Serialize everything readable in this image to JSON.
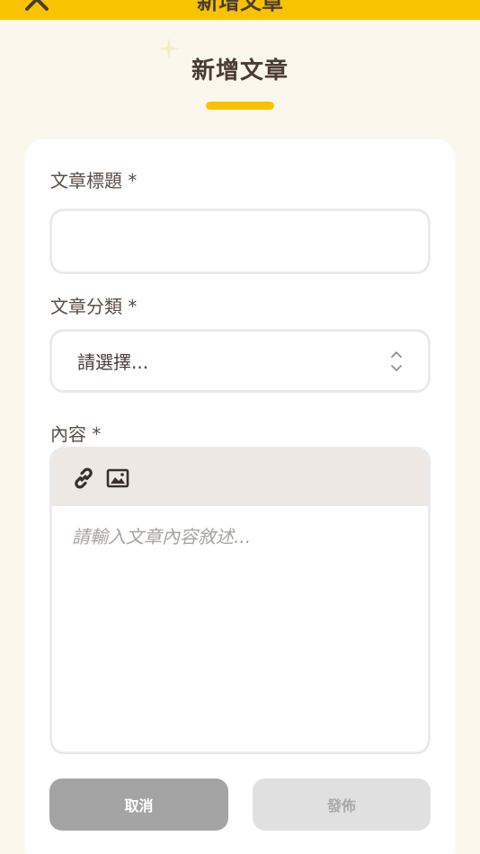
{
  "header": {
    "title": "新增文章"
  },
  "page": {
    "title": "新增文章"
  },
  "form": {
    "title_label": "文章標題 *",
    "title_value": "",
    "category_label": "文章分類 *",
    "category_value": "請選擇...",
    "content_label": "內容 *",
    "content_placeholder": "請輸入文章內容敘述..."
  },
  "editor_toolbar": {
    "icons": [
      "link-icon",
      "image-icon"
    ]
  },
  "actions": {
    "cancel_label": "取消",
    "publish_label": "發佈"
  },
  "colors": {
    "accent": "#f9c300",
    "background": "#fbf7ec",
    "text": "#4a3b34",
    "cancel_bg": "#a4a4a4",
    "publish_disabled_bg": "#e0e0e0"
  }
}
